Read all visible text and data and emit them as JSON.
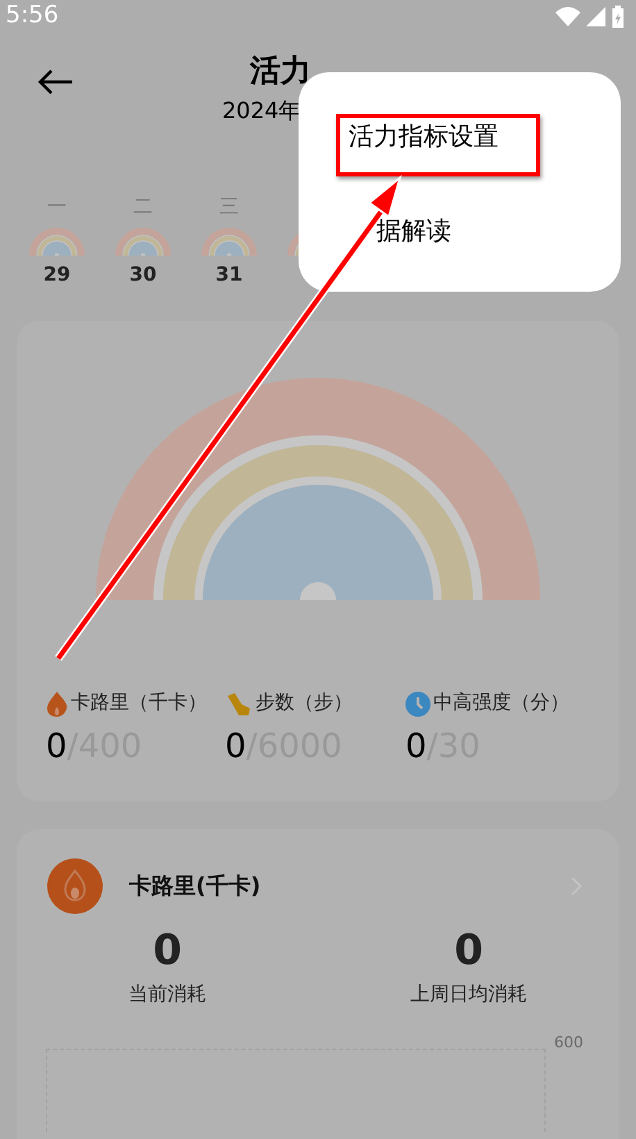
{
  "status_bar": {
    "time": "5:56"
  },
  "header": {
    "title": "活力",
    "date": "2024年"
  },
  "week": [
    {
      "weekday": "一",
      "date": "29"
    },
    {
      "weekday": "二",
      "date": "30"
    },
    {
      "weekday": "三",
      "date": "31"
    }
  ],
  "summary": {
    "metrics": [
      {
        "kind": "flame",
        "label": "卡路里（千卡）",
        "value": "0",
        "goal": "/400"
      },
      {
        "kind": "shoe",
        "label": "步数（步）",
        "value": "0",
        "goal": "/6000"
      },
      {
        "kind": "clock",
        "label": "中高强度（分）",
        "value": "0",
        "goal": "/30"
      }
    ]
  },
  "detail": {
    "title": "卡路里(千卡)",
    "stats": [
      {
        "value": "0",
        "label": "当前消耗"
      },
      {
        "value": "0",
        "label": "上周日均消耗"
      }
    ],
    "axis_label": "600"
  },
  "menu": {
    "items": [
      {
        "label": "活力指标设置",
        "highlighted": true
      },
      {
        "label": "据解读",
        "highlighted": false
      }
    ]
  }
}
